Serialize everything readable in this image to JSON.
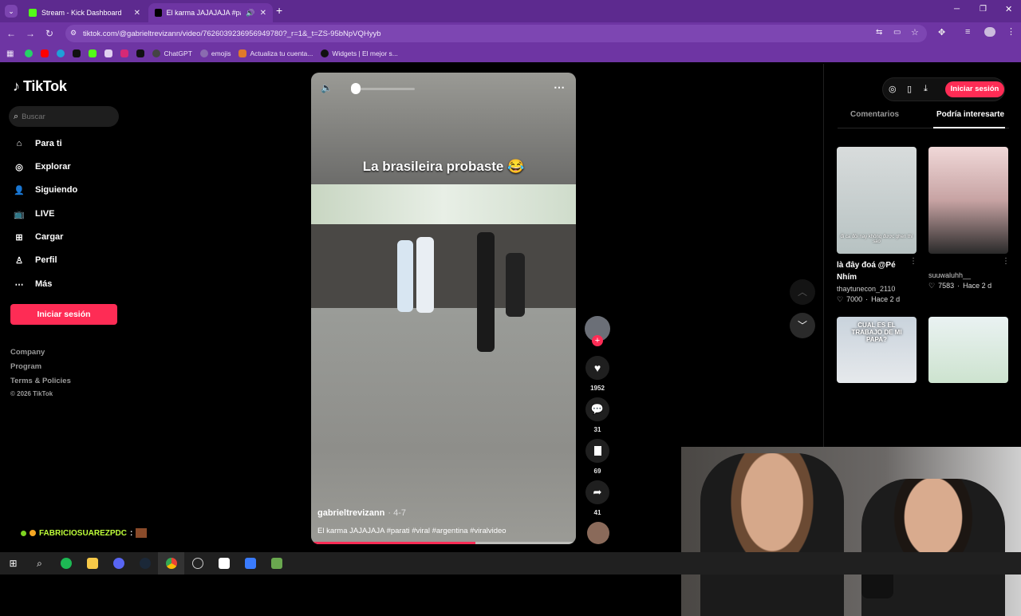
{
  "browser": {
    "tabs": [
      {
        "title": "Stream - Kick Dashboard",
        "favicon": "kick-icon",
        "active": false
      },
      {
        "title": "El karma JAJAJAJA #parati",
        "favicon": "tiktok-icon",
        "active": true
      }
    ],
    "new_tab": "+",
    "url": "tiktok.com/@gabrieltrevizann/video/7626039236956949780?_r=1&_t=ZS-95bNpVQHyyb",
    "bookmarks": [
      "ChatGPT",
      "emojis",
      "Actualiza tu cuenta...",
      "Widgets | El mejor s..."
    ]
  },
  "tiktok": {
    "logo": "TikTok",
    "search_placeholder": "Buscar",
    "nav": [
      "Para ti",
      "Explorar",
      "Siguiendo",
      "LIVE",
      "Cargar",
      "Perfil",
      "Más"
    ],
    "login_button": "Iniciar sesión",
    "footer": [
      "Company",
      "Program",
      "Terms & Policies",
      "© 2026 TikTok"
    ],
    "video": {
      "overlay_caption": "La brasileira probaste 😂",
      "author": "gabrieltrevizann",
      "date": "4-7",
      "description": "El karma JAJAJAJA #parati #viral #argentina #viralvideo",
      "progress": 0.62
    },
    "actions": {
      "likes": "1952",
      "comments": "31",
      "saves": "69",
      "shares": "41"
    },
    "right_panel": {
      "login_button": "Iniciar sesión",
      "tabs": [
        "Comentarios",
        "Podría interesarte"
      ],
      "videos": [
        {
          "caption": "là đây đoá @Pé Nhím",
          "overlay": "đi ca đôi nay không được ghen thì sao",
          "user": "thaytunecon_2110",
          "likes": "7000",
          "time": "Hace 2 d"
        },
        {
          "caption": "",
          "user": "suuwaluhh__",
          "likes": "7583",
          "time": "Hace 2 d"
        },
        {
          "overlay": "CUAL ES EL TRABAJO DE MI PAPA?"
        },
        {
          "overlay": ""
        }
      ]
    }
  },
  "stream_chat": {
    "user": "FABRICIOSUAREZPDC",
    "sep": ":"
  },
  "colors": {
    "accent": "#fe2c55",
    "chrome": "#6e35a3",
    "tabbar": "#5d2a8f"
  }
}
